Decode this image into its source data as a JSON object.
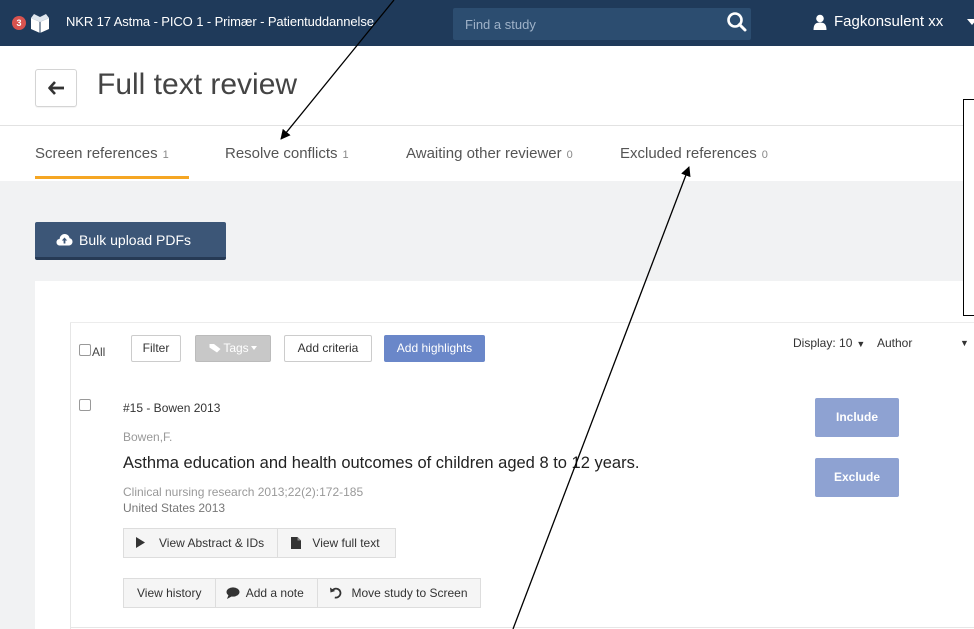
{
  "navbar": {
    "badge_count": "3",
    "logo_icon": "box-logo-icon",
    "project_title": "NKR 17 Astma - PICO 1 - Primær - Patientuddannelse",
    "search_placeholder": "Find a study",
    "search_icon": "search-icon",
    "user_icon": "user-icon",
    "user_name": "Fagkonsulent xx"
  },
  "header": {
    "back_icon": "arrow-left-icon",
    "title": "Full text review"
  },
  "tabs": [
    {
      "label": "Screen references",
      "count": "1",
      "active": true
    },
    {
      "label": "Resolve conflicts",
      "count": "1",
      "active": false
    },
    {
      "label": "Awaiting other reviewer",
      "count": "0",
      "active": false
    },
    {
      "label": "Excluded references",
      "count": "0",
      "active": false
    }
  ],
  "actions": {
    "bulk_upload_label": "Bulk upload PDFs",
    "bulk_upload_icon": "cloud-upload-icon"
  },
  "toolbar": {
    "all_label": "All",
    "filter_label": "Filter",
    "tags_label": "Tags",
    "add_criteria_label": "Add criteria",
    "add_highlights_label": "Add highlights",
    "display_label": "Display: 10",
    "sort_label": "Author"
  },
  "reference": {
    "id": "#15 - Bowen 2013",
    "author": "Bowen,F.",
    "title": "Asthma education and health outcomes of children aged 8 to 12 years.",
    "journal": "Clinical nursing research 2013;22(2):172-185",
    "country_year": "United States 2013",
    "view_abstract_label": "View Abstract & IDs",
    "view_full_text_label": "View full text",
    "view_history_label": "View history",
    "add_note_label": "Add a note",
    "move_study_label": "Move study to Screen",
    "include_label": "Include",
    "exclude_label": "Exclude"
  },
  "colors": {
    "navbar": "#1f3a5a",
    "active_tab": "#f5a623",
    "primary_button": "#3c5677",
    "decision_button": "#8ea2d2",
    "highlight_button": "#6a87c9"
  }
}
